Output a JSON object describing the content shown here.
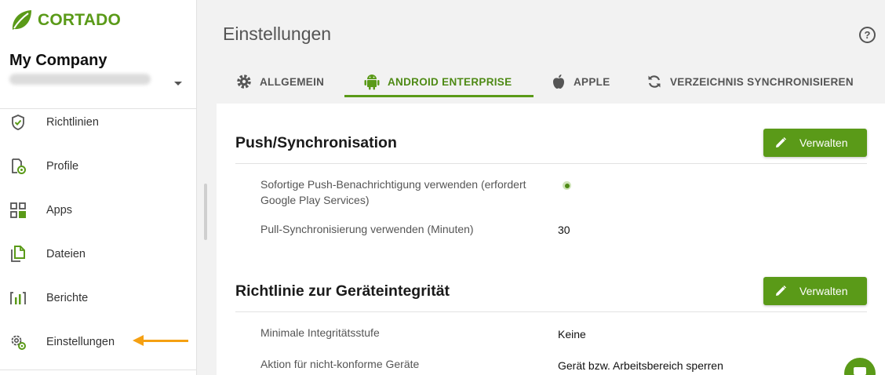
{
  "brand": {
    "name": "CORTADO",
    "color": "#5a9a18"
  },
  "account": {
    "company": "My Company"
  },
  "sidebar": {
    "items": [
      {
        "label": "Richtlinien",
        "icon": "shield-check-icon"
      },
      {
        "label": "Profile",
        "icon": "profile-document-icon"
      },
      {
        "label": "Apps",
        "icon": "apps-grid-icon"
      },
      {
        "label": "Dateien",
        "icon": "files-icon"
      },
      {
        "label": "Berichte",
        "icon": "reports-chart-icon"
      },
      {
        "label": "Einstellungen",
        "icon": "gear-icon"
      }
    ]
  },
  "header": {
    "title": "Einstellungen",
    "help_symbol": "?"
  },
  "tabs": [
    {
      "label": "ALLGEMEIN",
      "icon": "gear-icon"
    },
    {
      "label": "ANDROID ENTERPRISE",
      "icon": "android-icon",
      "active": true
    },
    {
      "label": "APPLE",
      "icon": "apple-icon"
    },
    {
      "label": "VERZEICHNIS SYNCHRONISIEREN",
      "icon": "sync-icon"
    }
  ],
  "sections": [
    {
      "title": "Push/Synchronisation",
      "button_label": "Verwalten",
      "rows": [
        {
          "label": "Sofortige Push-Benachrichtigung verwenden (erfordert Google Play Services)",
          "value_type": "radio-on"
        },
        {
          "label": "Pull-Synchronisierung verwenden (Minuten)",
          "value": "30"
        }
      ]
    },
    {
      "title": "Richtlinie zur Geräteintegrität",
      "button_label": "Verwalten",
      "rows": [
        {
          "label": "Minimale Integritätsstufe",
          "value": "Keine"
        },
        {
          "label": "Aktion für nicht-konforme Geräte",
          "value": "Gerät bzw. Arbeitsbereich sperren"
        }
      ]
    }
  ],
  "colors": {
    "accent": "#5a9a18",
    "annotation_arrow": "#f5a012"
  }
}
